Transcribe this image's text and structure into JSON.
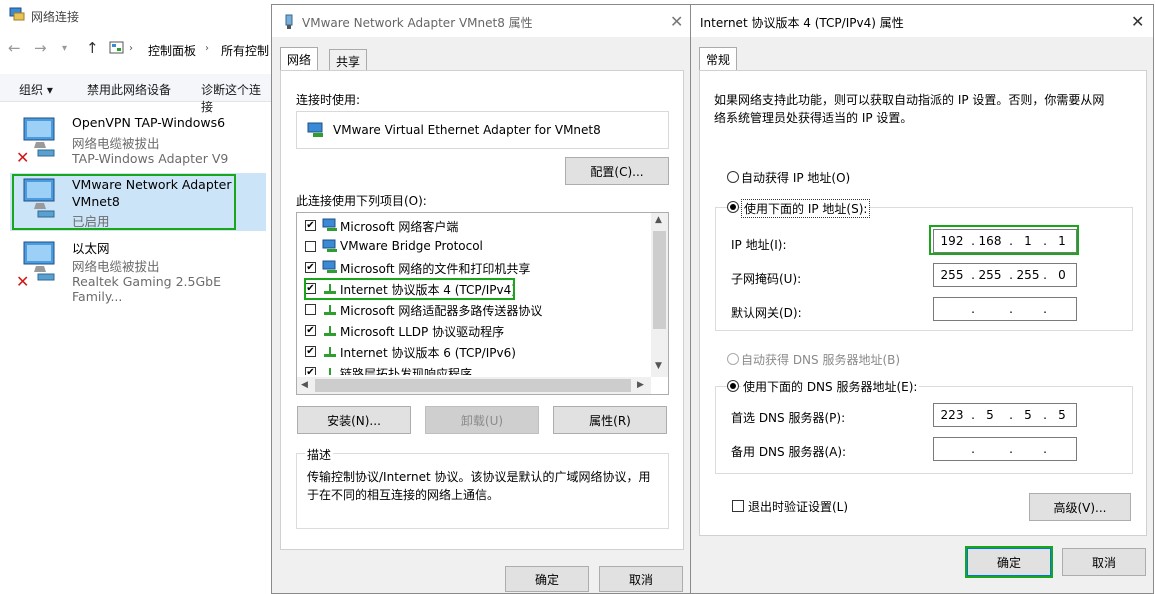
{
  "network_window": {
    "title": "网络连接",
    "breadcrumb": [
      "控制面板",
      "所有控制"
    ],
    "commands": [
      "组织 ▾",
      "禁用此网络设备",
      "诊断这个连接"
    ],
    "adapters": [
      {
        "name": "OpenVPN TAP-Windows6",
        "status": "网络电缆被拔出",
        "device": "TAP-Windows Adapter V9",
        "disconnected": true,
        "selected": false
      },
      {
        "name": "VMware Network Adapter",
        "status": "VMnet8",
        "device": "已启用",
        "disconnected": false,
        "selected": true
      },
      {
        "name": "以太网",
        "status": "网络电缆被拔出",
        "device": "Realtek Gaming 2.5GbE Family...",
        "disconnected": true,
        "selected": false
      }
    ]
  },
  "adapter_dialog": {
    "title": "VMware Network Adapter VMnet8 属性",
    "tabs": [
      "网络",
      "共享"
    ],
    "connect_using_label": "连接时使用:",
    "device_name": "VMware Virtual Ethernet Adapter for VMnet8",
    "configure_button": "配置(C)...",
    "items_label": "此连接使用下列项目(O):",
    "items": [
      {
        "label": "Microsoft 网络客户端",
        "checked": true,
        "icon": "network-client-icon"
      },
      {
        "label": "VMware Bridge Protocol",
        "checked": false,
        "icon": "network-client-icon"
      },
      {
        "label": "Microsoft 网络的文件和打印机共享",
        "checked": true,
        "icon": "network-client-icon"
      },
      {
        "label": "Internet 协议版本 4 (TCP/IPv4)",
        "checked": true,
        "icon": "protocol-icon"
      },
      {
        "label": "Microsoft 网络适配器多路传送器协议",
        "checked": false,
        "icon": "protocol-icon"
      },
      {
        "label": "Microsoft LLDP 协议驱动程序",
        "checked": true,
        "icon": "protocol-icon"
      },
      {
        "label": "Internet 协议版本 6 (TCP/IPv6)",
        "checked": true,
        "icon": "protocol-icon"
      },
      {
        "label": "链路层拓扑发现响应程序",
        "checked": true,
        "icon": "protocol-icon"
      }
    ],
    "install_button": "安装(N)...",
    "uninstall_button": "卸载(U)",
    "properties_button": "属性(R)",
    "description_title": "描述",
    "description_text": "传输控制协议/Internet 协议。该协议是默认的广域网络协议，用于在不同的相互连接的网络上通信。",
    "ok_button": "确定",
    "cancel_button": "取消"
  },
  "ipv4_dialog": {
    "title": "Internet 协议版本 4 (TCP/IPv4) 属性",
    "tab": "常规",
    "intro": "如果网络支持此功能，则可以获取自动指派的 IP 设置。否则，你需要从网络系统管理员处获得适当的 IP 设置。",
    "auto_ip": "自动获得 IP 地址(O)",
    "manual_ip": "使用下面的 IP 地址(S):",
    "ip_label": "IP 地址(I):",
    "ip_value": [
      "192",
      "168",
      "1",
      "1"
    ],
    "mask_label": "子网掩码(U):",
    "mask_value": [
      "255",
      "255",
      "255",
      "0"
    ],
    "gateway_label": "默认网关(D):",
    "gateway_value": [
      "",
      "",
      "",
      ""
    ],
    "auto_dns": "自动获得 DNS 服务器地址(B)",
    "manual_dns": "使用下面的 DNS 服务器地址(E):",
    "dns1_label": "首选 DNS 服务器(P):",
    "dns1_value": [
      "223",
      "5",
      "5",
      "5"
    ],
    "dns2_label": "备用 DNS 服务器(A):",
    "dns2_value": [
      "",
      "",
      "",
      ""
    ],
    "validate_label": "退出时验证设置(L)",
    "advanced_button": "高级(V)...",
    "ok_button": "确定",
    "cancel_button": "取消",
    "close_glyph": "✕"
  },
  "colors": {
    "highlight": "#1aa61a",
    "selection": "#cce4f7",
    "accent": "#0078d7"
  }
}
